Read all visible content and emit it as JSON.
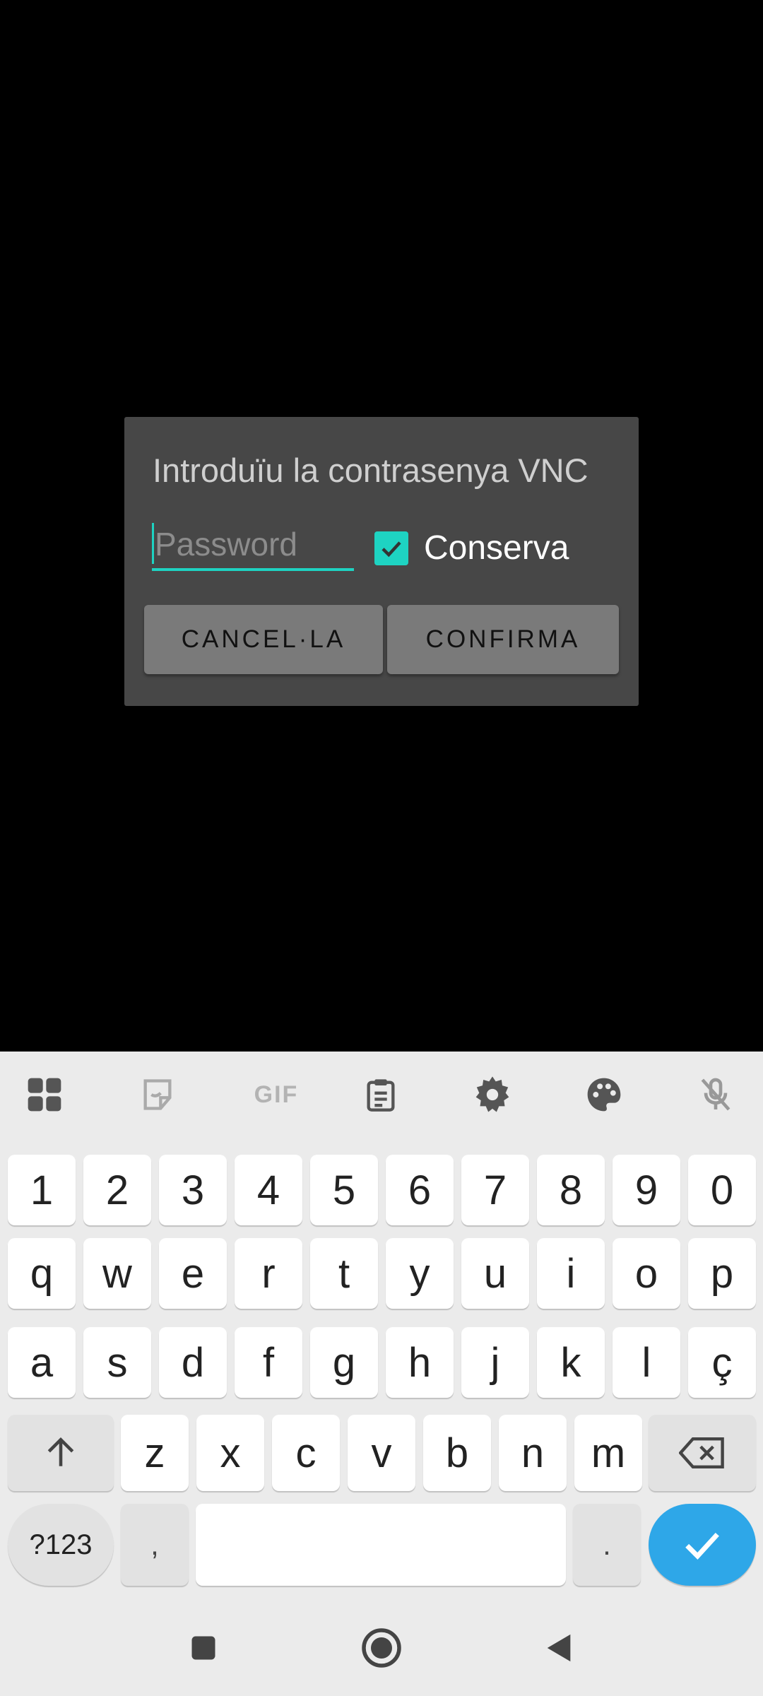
{
  "dialog": {
    "title": "Introduïu la contrasenya VNC",
    "password_placeholder": "Password",
    "password_value": "",
    "keep_label": "Conserva",
    "keep_checked": true,
    "cancel_label": "CANCEL·LA",
    "confirm_label": "CONFIRMA",
    "accent_color": "#1ed3c2"
  },
  "keyboard": {
    "toolbar": [
      "apps-grid-icon",
      "sticker-icon",
      "gif-icon",
      "clipboard-icon",
      "settings-gear-icon",
      "palette-icon",
      "mic-off-icon"
    ],
    "gif_label": "GIF",
    "row_numbers": [
      "1",
      "2",
      "3",
      "4",
      "5",
      "6",
      "7",
      "8",
      "9",
      "0"
    ],
    "row_top": [
      "q",
      "w",
      "e",
      "r",
      "t",
      "y",
      "u",
      "i",
      "o",
      "p"
    ],
    "row_middle": [
      "a",
      "s",
      "d",
      "f",
      "g",
      "h",
      "j",
      "k",
      "l",
      "ç"
    ],
    "row_bottom": [
      "z",
      "x",
      "c",
      "v",
      "b",
      "n",
      "m"
    ],
    "symbols_label": "?123",
    "comma_label": ",",
    "period_label": ".",
    "enter_color": "#2ea7e8"
  },
  "navbar": [
    "recents-square-icon",
    "home-circle-icon",
    "back-triangle-icon"
  ]
}
